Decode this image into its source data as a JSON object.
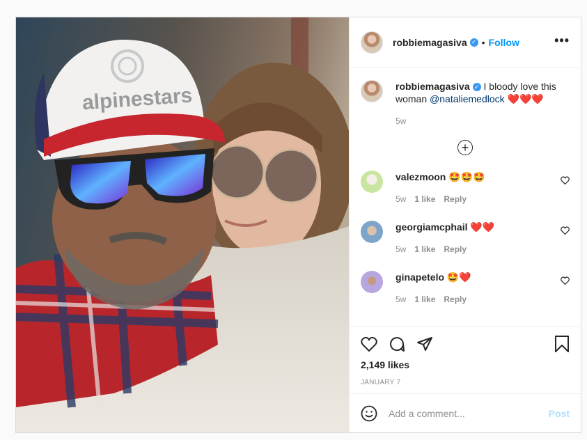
{
  "post": {
    "author": "robbiemagasiva",
    "follow_label": "Follow",
    "separator": "•",
    "more_label": "•••",
    "caption": {
      "username": "robbiemagasiva",
      "text": " I bloody love this woman ",
      "mention": "@nataliemedlock",
      "emoji": " ❤️❤️❤️",
      "time": "5w"
    },
    "load_more_label": "+",
    "comments": [
      {
        "username": "valezmoon",
        "text": "🤩🤩🤩",
        "time": "5w",
        "likes": "1 like",
        "reply": "Reply",
        "avatar_color": "#c8e6a0"
      },
      {
        "username": "georgiamcphail",
        "text": "❤️❤️",
        "time": "5w",
        "likes": "1 like",
        "reply": "Reply",
        "avatar_color": "#7fa4c9"
      },
      {
        "username": "ginapetelo",
        "text": "🤩❤️",
        "time": "5w",
        "likes": "1 like",
        "reply": "Reply",
        "avatar_color": "#b8a6e0"
      }
    ],
    "like_count": "2,149 likes",
    "date": "January 7",
    "add_comment_placeholder": "Add a comment...",
    "post_button": "Post",
    "icons": {
      "like": "heart-icon",
      "comment": "comment-icon",
      "share": "share-icon",
      "save": "bookmark-icon",
      "emoji": "emoji-icon"
    },
    "colors": {
      "link": "#0095f6",
      "mention": "#00376b",
      "muted": "#8e8e8e",
      "post_disabled": "#b2dffc"
    }
  }
}
